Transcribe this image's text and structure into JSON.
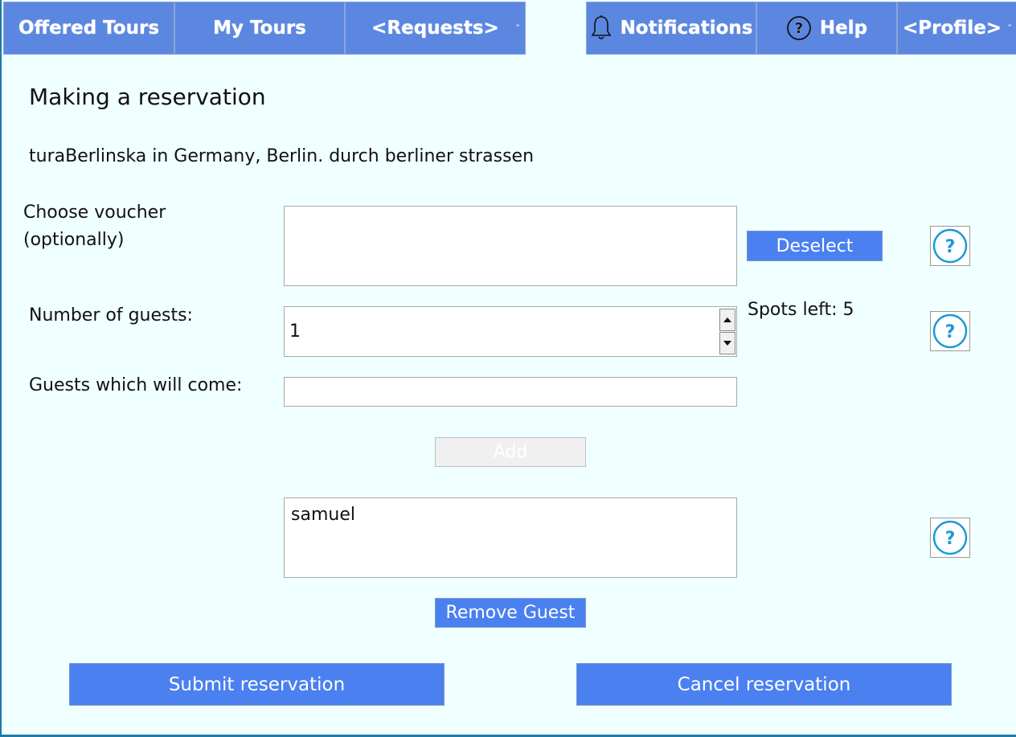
{
  "nav": {
    "offered_tours": "Offered Tours",
    "my_tours": "My Tours",
    "requests": "<Requests>",
    "notifications": "Notifications",
    "help": "Help",
    "profile": "<Profile>",
    "chevron": "ˇ"
  },
  "page": {
    "title": "Making a reservation",
    "tour_info": "turaBerlinska in Germany, Berlin. durch berliner strassen"
  },
  "voucher": {
    "label_line1": "Choose voucher",
    "label_line2": "(optionally)",
    "deselect_label": "Deselect"
  },
  "guests": {
    "number_label": "Number of guests:",
    "number_value": "1",
    "spots_left": "Spots left: 5",
    "names_label": "Guests which will come:",
    "name_input_value": "",
    "add_label": "Add",
    "list": [
      "samuel"
    ],
    "remove_label": "Remove Guest"
  },
  "actions": {
    "submit_label": "Submit reservation",
    "cancel_label": "Cancel reservation"
  },
  "help_glyph": "?",
  "colors": {
    "background": "#f0ffff",
    "nav_tab": "#5b87e0",
    "button": "#4a80f0",
    "help_icon": "#1a9ad6"
  }
}
